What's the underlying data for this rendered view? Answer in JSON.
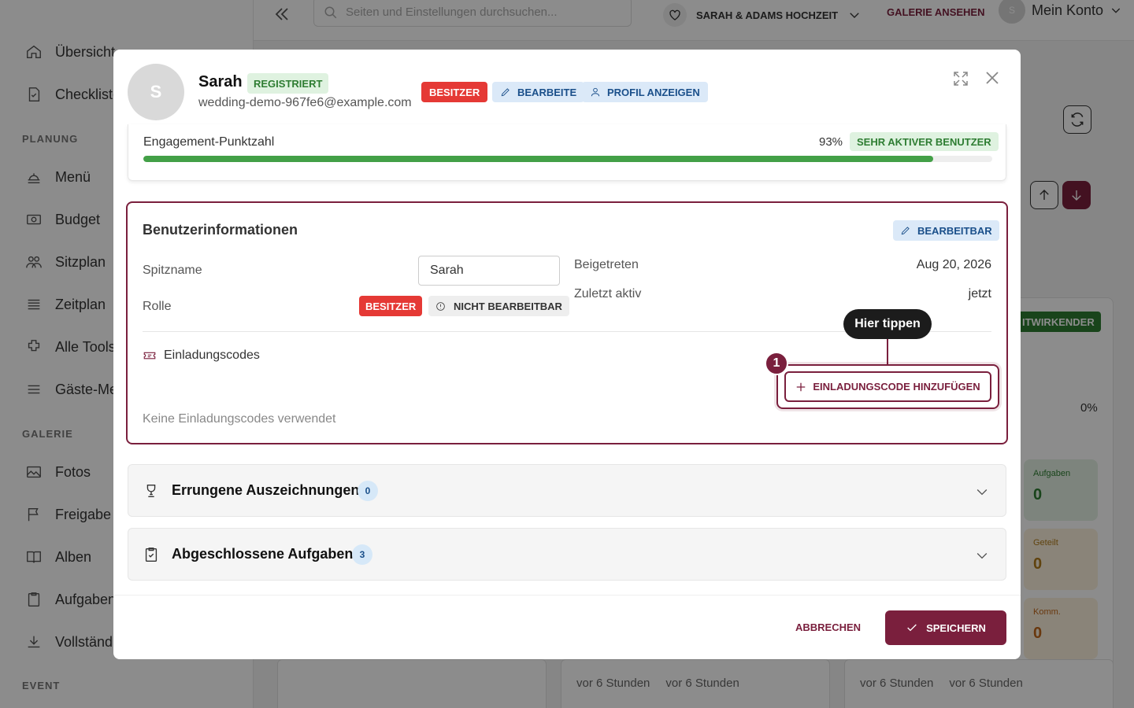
{
  "sidebar": {
    "items": [
      {
        "label": "Übersicht",
        "icon": "home-icon"
      },
      {
        "label": "Checkliste",
        "icon": "checklist-icon"
      },
      {
        "label": "Menü",
        "icon": "menu-icon"
      },
      {
        "label": "Budget",
        "icon": "budget-icon"
      },
      {
        "label": "Sitzplan",
        "icon": "seating-icon"
      },
      {
        "label": "Zeitplan",
        "icon": "timeline-icon"
      },
      {
        "label": "Alle Tools",
        "icon": "tools-icon"
      },
      {
        "label": "Gäste-Me",
        "icon": "guest-menu-icon"
      },
      {
        "label": "Fotos",
        "icon": "photo-icon"
      },
      {
        "label": "Freigabe",
        "icon": "flag-icon"
      },
      {
        "label": "Alben",
        "icon": "album-icon"
      },
      {
        "label": "Aufgaben",
        "icon": "clipboard-icon"
      },
      {
        "label": "Vollständ",
        "icon": "download-icon"
      }
    ],
    "sections": [
      "PLANUNG",
      "GALERIE",
      "EVENT"
    ]
  },
  "topbar": {
    "search_placeholder": "Seiten und Einstellungen durchsuchen...",
    "event_name": "SARAH & ADAMS HOCHZEIT",
    "gallery_link": "GALERIE ANSEHEN",
    "account_avatar": "S",
    "account_label": "Mein Konto"
  },
  "background": {
    "collab_badge": "ITWIRKENDER",
    "progress_pct": "0%",
    "stats": [
      {
        "label": "Aufgaben",
        "value": "0"
      },
      {
        "label": "Geteilt",
        "value": "0"
      },
      {
        "label": "Komm.",
        "value": "0"
      }
    ],
    "time_a": "vor 6 Stunden",
    "time_b": "vor 6 Stunden"
  },
  "modal": {
    "avatar_letter": "S",
    "user_name": "Sarah",
    "status_badge": "REGISTRIERT",
    "email": "wedding-demo-967fe6@example.com",
    "chip_owner": "BESITZER",
    "chip_edit": "BEARBEITE",
    "chip_profile": "PROFIL ANZEIGEN",
    "engagement": {
      "label": "Engagement-Punktzahl",
      "value_text": "93%",
      "value": 0.93,
      "badge": "SEHR AKTIVER BENUTZER"
    },
    "user_info": {
      "title": "Benutzerinformationen",
      "editable_badge": "BEARBEITBAR",
      "nickname_label": "Spitzname",
      "nickname_value": "Sarah",
      "role_label": "Rolle",
      "role_owner": "BESITZER",
      "role_not_editable": "NICHT BEARBEITBAR",
      "joined_label": "Beigetreten",
      "joined_value": "Aug 20, 2026",
      "last_active_label": "Zuletzt aktiv",
      "last_active_value": "jetzt",
      "codes_title": "Einladungscodes",
      "codes_empty": "Keine Einladungscodes verwendet",
      "add_code_button": "EINLADUNGSCODE HINZUFÜGEN",
      "tooltip": "Hier tippen",
      "step_number": "1"
    },
    "achievements": {
      "title": "Errungene Auszeichnungen",
      "count": "0"
    },
    "tasks": {
      "title": "Abgeschlossene Aufgaben",
      "count": "3"
    },
    "footer": {
      "cancel": "ABBRECHEN",
      "save": "SPEICHERN"
    }
  },
  "colors": {
    "brand": "#7a1f3d",
    "owner_red": "#e53935",
    "success_green": "#43a047",
    "info_blue": "#1a4f8a"
  }
}
